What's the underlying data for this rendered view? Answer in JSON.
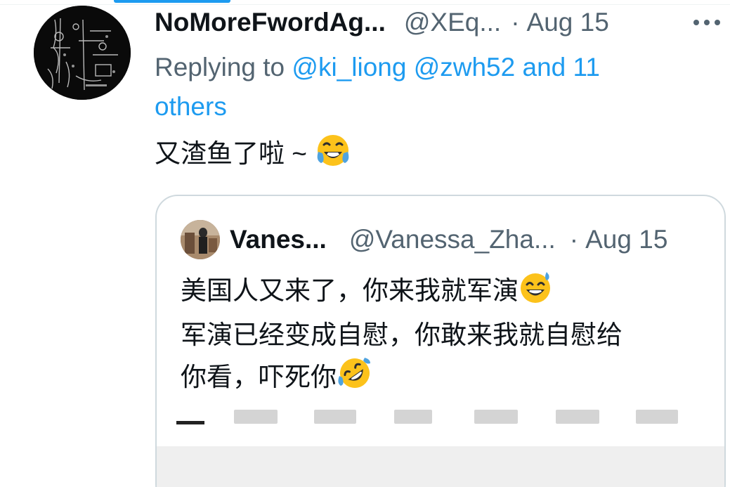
{
  "tweet": {
    "display_name": "NoMoreFwordAg...",
    "handle": "@XEq...",
    "separator": "·",
    "date": "Aug 15",
    "reply_prefix": "Replying to",
    "reply_mentions": "@ki_liong @zwh52 and 11 others",
    "text": "又渣鱼了啦 ~",
    "text_emoji": "face-with-tears-of-joy"
  },
  "quoted": {
    "display_name": "Vanes...",
    "handle": "@Vanessa_Zha...",
    "separator": "·",
    "date": "Aug 15",
    "lines": [
      "美国人又来了，你来我就军演",
      "军演已经变成自慰，你敢来我就自慰给",
      "你看，吓死你"
    ],
    "line_emojis": [
      "grinning-face-with-sweat",
      "",
      "rolling-on-the-floor-laughing"
    ]
  },
  "colors": {
    "accent": "#1d9bf0",
    "secondary_text": "#536471",
    "border": "#cfd9de"
  }
}
